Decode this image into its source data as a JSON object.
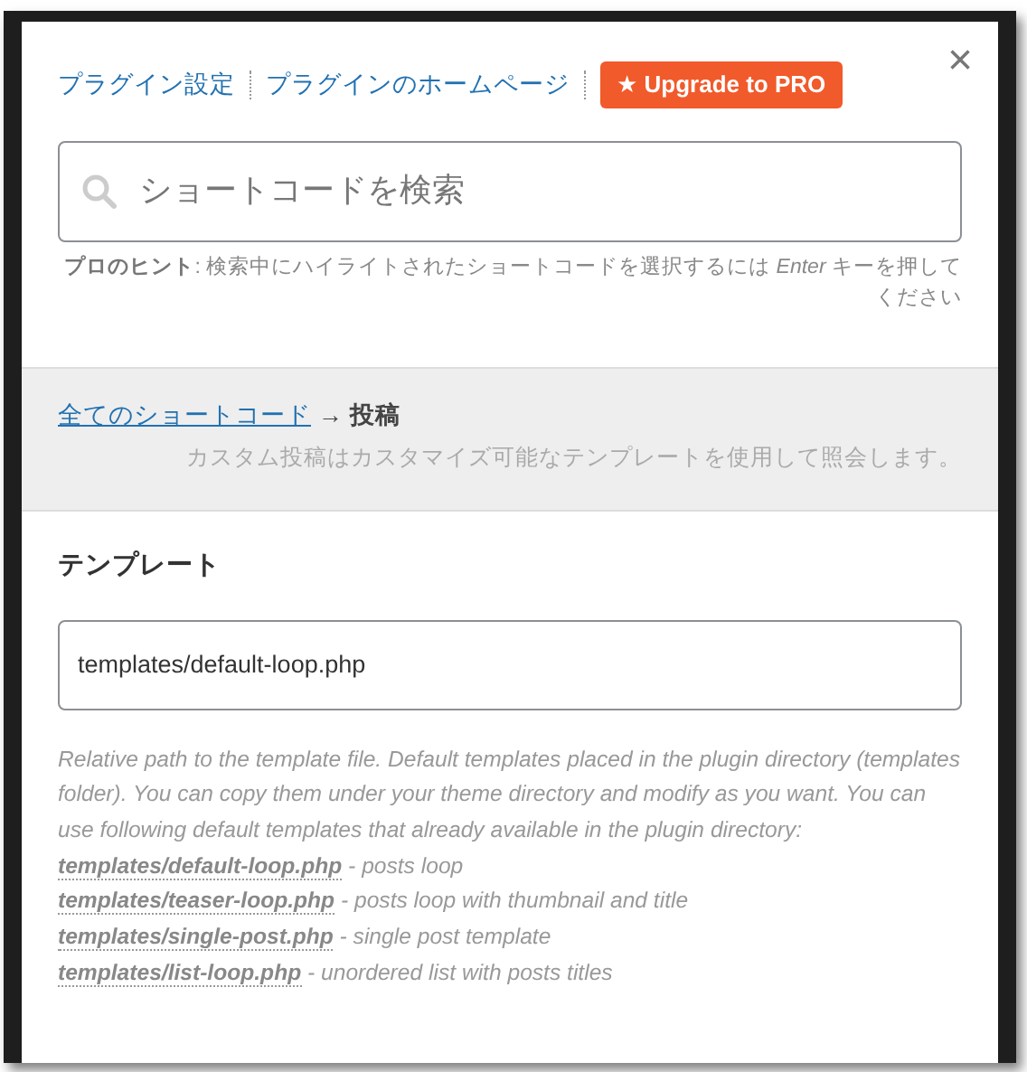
{
  "header_links": [
    {
      "label": "プラグイン設定"
    },
    {
      "label": "プラグインのホームページ"
    }
  ],
  "upgrade_button": {
    "icon": "★",
    "label": "Upgrade to PRO"
  },
  "close_button": {
    "label": "×"
  },
  "search": {
    "placeholder": "ショートコードを検索"
  },
  "hint": "**プロのヒント**: 検索中にハイライトされたショートコードを選択するには *Enter* キーを押してください",
  "breadcrumb": {
    "link": "全てのショートコード",
    "current": "→ 投稿"
  },
  "shortcode_description": "カスタム投稿はカスタマイズ可能なテンプレートを使用して照会します。",
  "field": {
    "label": "テンプレート",
    "value": "templates/default-loop.php"
  },
  "help_text": "Relative path to the template file. Default templates placed in the plugin directory (templates folder). You can copy them under your theme directory and modify as you want. You can use following default templates that already available in the plugin directory:",
  "templates": [
    {
      "file": "templates/default-loop.php",
      "description": "- posts loop"
    },
    {
      "file": "templates/teaser-loop.php",
      "description": "- posts loop with thumbnail and title"
    },
    {
      "file": "templates/single-post.php",
      "description": "- single post template"
    },
    {
      "file": "templates/list-loop.php",
      "description": "- unordered list with posts titles"
    }
  ]
}
